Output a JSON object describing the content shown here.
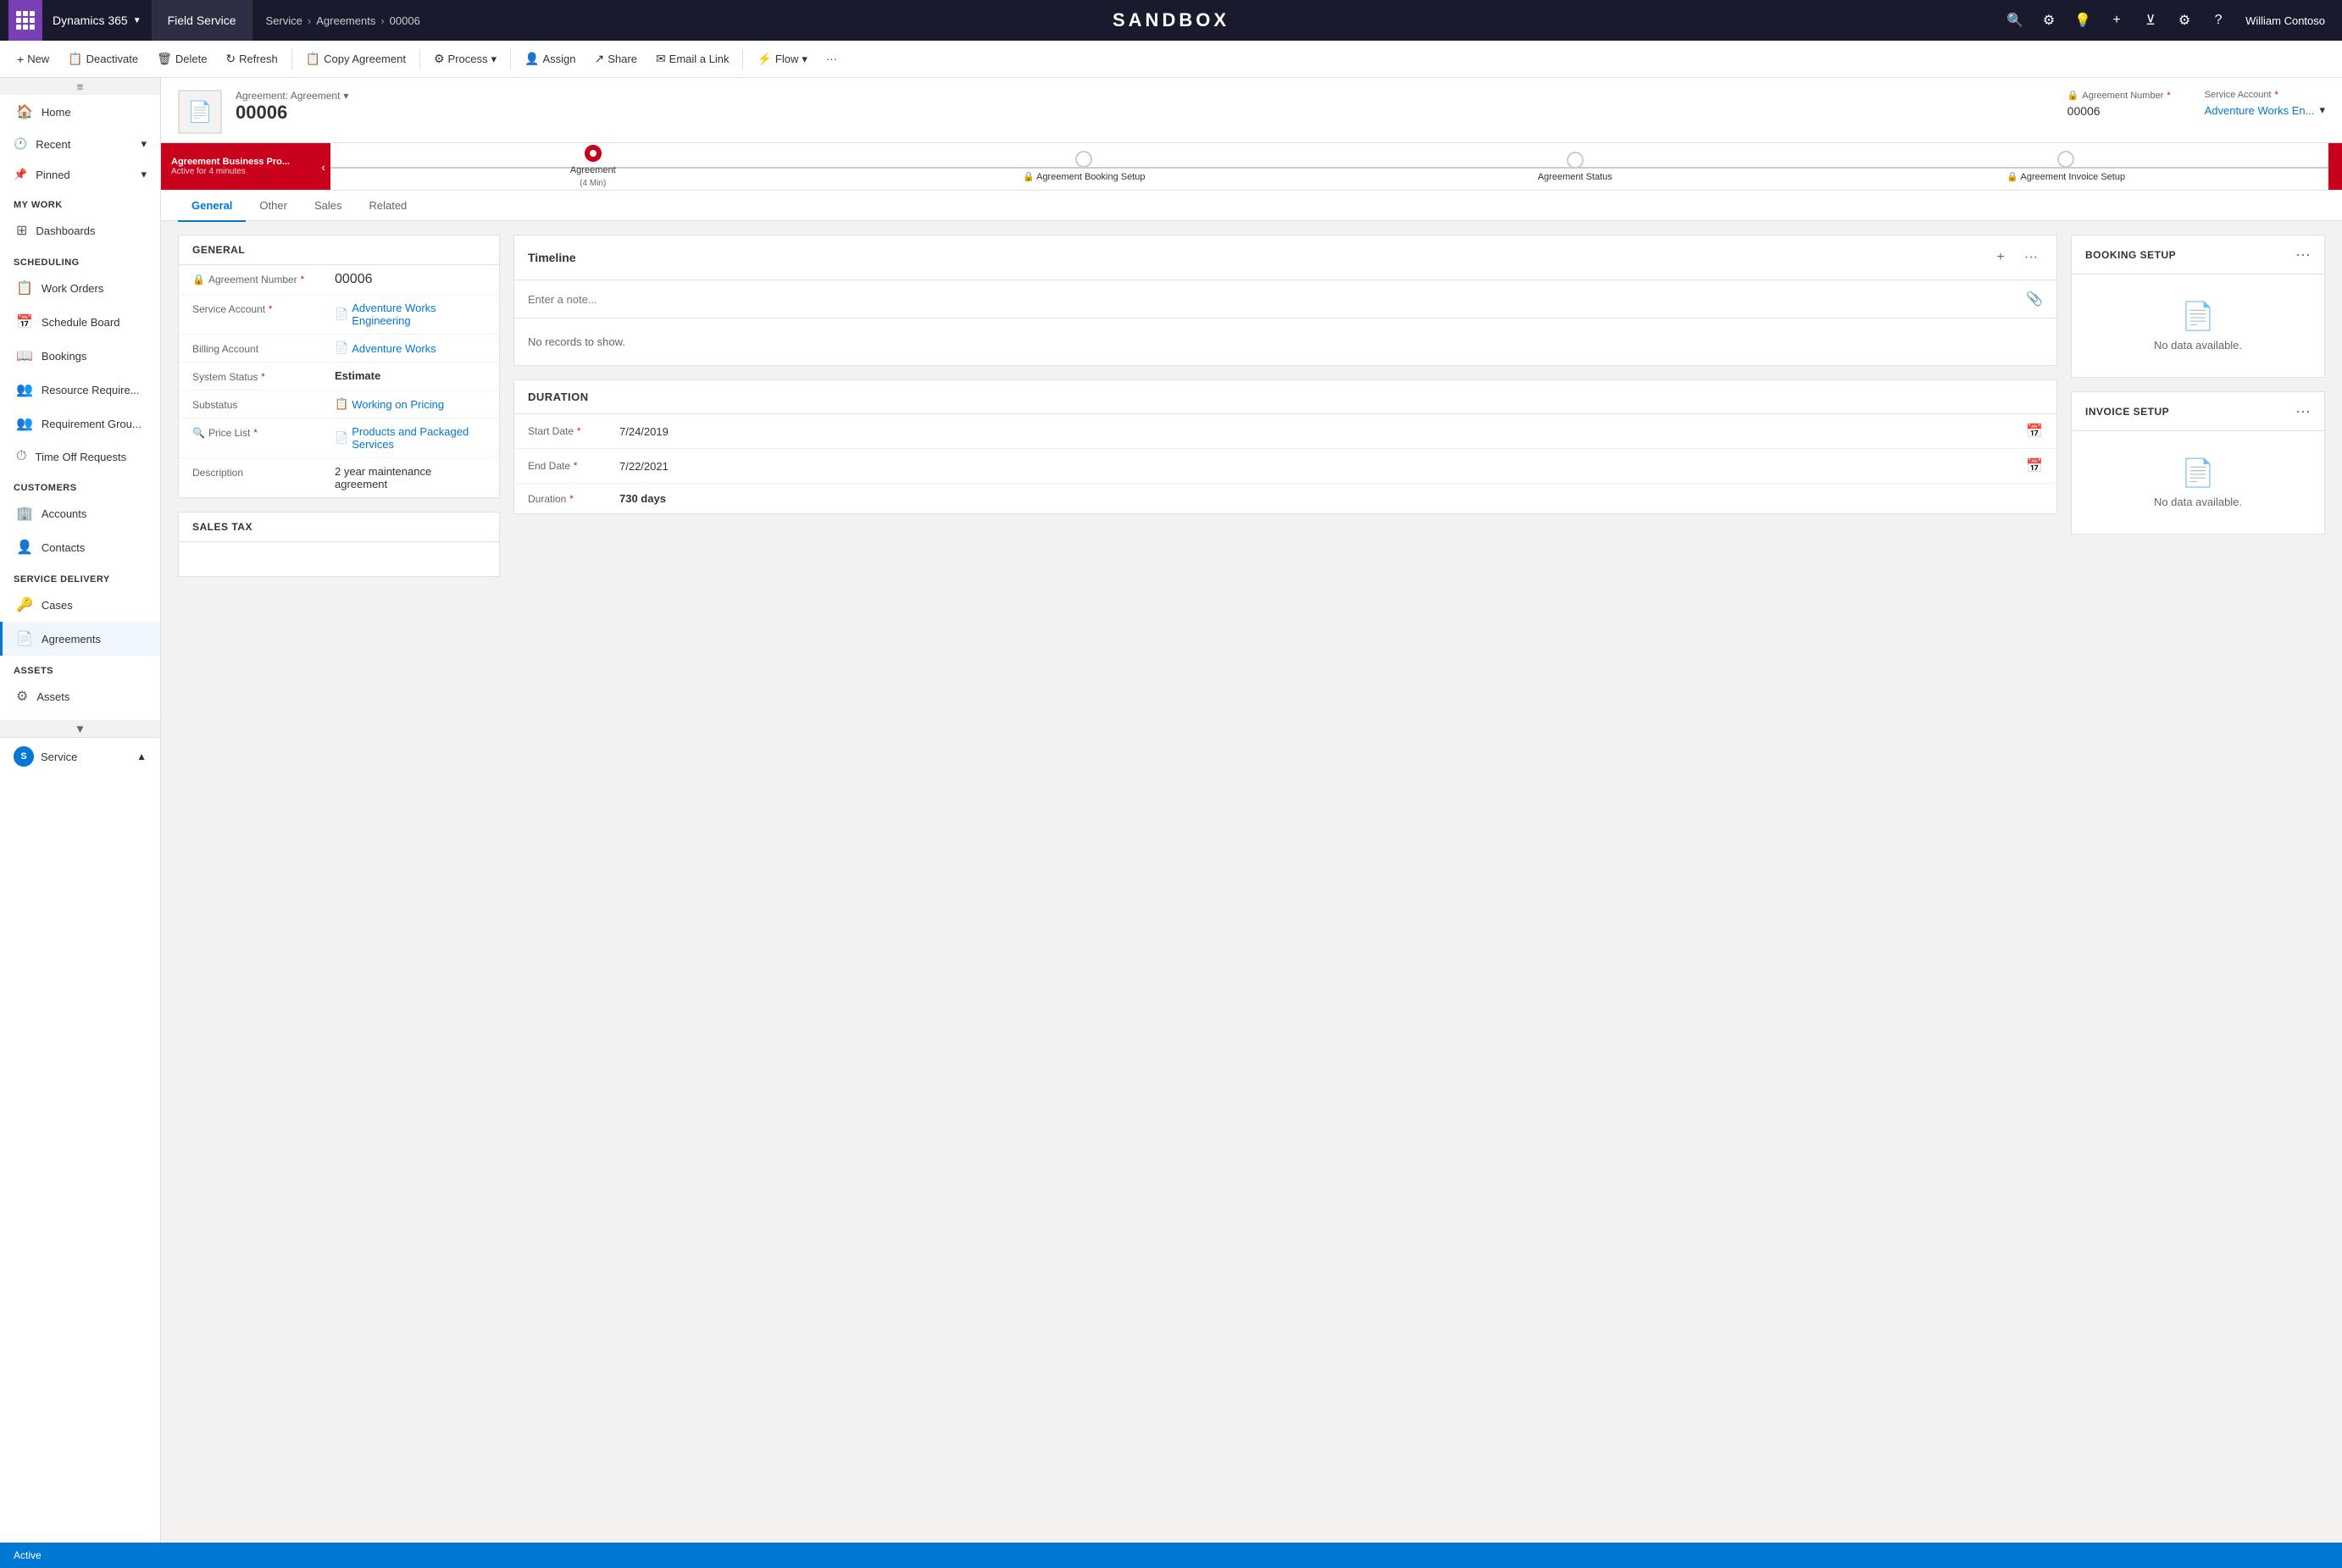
{
  "topnav": {
    "app_label": "Dynamics 365",
    "module_label": "Field Service",
    "breadcrumb": [
      "Service",
      "Agreements",
      "00006"
    ],
    "sandbox_label": "SANDBOX",
    "user_name": "William Contoso",
    "icons": [
      "search",
      "settings-cog",
      "lightbulb",
      "plus",
      "funnel"
    ]
  },
  "toolbar": {
    "buttons": [
      {
        "label": "New",
        "icon": "+",
        "name": "new-button"
      },
      {
        "label": "Deactivate",
        "icon": "📋",
        "name": "deactivate-button"
      },
      {
        "label": "Delete",
        "icon": "🗑",
        "name": "delete-button"
      },
      {
        "label": "Refresh",
        "icon": "🔄",
        "name": "refresh-button"
      },
      {
        "label": "Copy Agreement",
        "icon": "📋",
        "name": "copy-agreement-button"
      },
      {
        "label": "Process",
        "icon": "⚙",
        "name": "process-button"
      },
      {
        "label": "Assign",
        "icon": "👤",
        "name": "assign-button"
      },
      {
        "label": "Share",
        "icon": "↗",
        "name": "share-button"
      },
      {
        "label": "Email a Link",
        "icon": "✉",
        "name": "email-link-button"
      },
      {
        "label": "Flow",
        "icon": "⚡",
        "name": "flow-button"
      },
      {
        "label": "...",
        "icon": "",
        "name": "more-button"
      }
    ]
  },
  "record": {
    "type_label": "Agreement: Agreement",
    "number": "00006",
    "agreement_number_label": "Agreement Number",
    "agreement_number_value": "00006",
    "service_account_label": "Service Account",
    "service_account_value": "Adventure Works En...",
    "required": "*"
  },
  "process_bar": {
    "left_panel_title": "Agreement Business Pro...",
    "left_panel_sub": "Active for 4 minutes",
    "steps": [
      {
        "label": "Agreement",
        "sublabel": "(4 Min)",
        "active": true,
        "locked": false
      },
      {
        "label": "Agreement Booking Setup",
        "sublabel": "",
        "active": false,
        "locked": true
      },
      {
        "label": "Agreement Status",
        "sublabel": "",
        "active": false,
        "locked": true
      },
      {
        "label": "Agreement Invoice Setup",
        "sublabel": "",
        "active": false,
        "locked": true
      }
    ]
  },
  "form_tabs": [
    {
      "label": "General",
      "active": true
    },
    {
      "label": "Other",
      "active": false
    },
    {
      "label": "Sales",
      "active": false
    },
    {
      "label": "Related",
      "active": false
    }
  ],
  "general_section": {
    "title": "GENERAL",
    "fields": [
      {
        "label": "Agreement Number",
        "value": "00006",
        "required": true,
        "locked": true,
        "link": false
      },
      {
        "label": "Service Account",
        "value": "Adventure Works Engineering",
        "required": true,
        "locked": false,
        "link": true
      },
      {
        "label": "Billing Account",
        "value": "Adventure Works",
        "required": false,
        "locked": false,
        "link": true
      },
      {
        "label": "System Status",
        "value": "Estimate",
        "required": true,
        "locked": false,
        "link": false,
        "bold": true
      },
      {
        "label": "Substatus",
        "value": "Working on Pricing",
        "required": false,
        "locked": false,
        "link": true
      },
      {
        "label": "Price List",
        "value": "Products and Packaged Services",
        "required": true,
        "locked": false,
        "link": true
      },
      {
        "label": "Description",
        "value": "2 year maintenance agreement",
        "required": false,
        "locked": false,
        "link": false
      }
    ]
  },
  "timeline": {
    "title": "Timeline",
    "input_placeholder": "Enter a note...",
    "empty_message": "No records to show."
  },
  "duration": {
    "title": "DURATION",
    "fields": [
      {
        "label": "Start Date",
        "value": "7/24/2019",
        "required": true
      },
      {
        "label": "End Date",
        "value": "7/22/2021",
        "required": true
      },
      {
        "label": "Duration",
        "value": "730 days",
        "required": true,
        "bold": true
      }
    ]
  },
  "booking_setup": {
    "title": "BOOKING SETUP",
    "empty_label": "No data available."
  },
  "invoice_setup": {
    "title": "INVOICE SETUP",
    "empty_label": "No data available."
  },
  "sales_tax": {
    "title": "SALES TAX"
  },
  "sidebar": {
    "items_top": [
      {
        "label": "Home",
        "icon": "🏠",
        "name": "sidebar-home"
      },
      {
        "label": "Recent",
        "icon": "🕐",
        "name": "sidebar-recent",
        "expandable": true
      },
      {
        "label": "Pinned",
        "icon": "📌",
        "name": "sidebar-pinned",
        "expandable": true
      }
    ],
    "my_work_section": "My Work",
    "my_work_items": [
      {
        "label": "Dashboards",
        "icon": "⊞",
        "name": "sidebar-dashboards"
      }
    ],
    "scheduling_section": "Scheduling",
    "scheduling_items": [
      {
        "label": "Work Orders",
        "icon": "📋",
        "name": "sidebar-work-orders"
      },
      {
        "label": "Schedule Board",
        "icon": "📅",
        "name": "sidebar-schedule-board"
      },
      {
        "label": "Bookings",
        "icon": "📖",
        "name": "sidebar-bookings"
      },
      {
        "label": "Resource Require...",
        "icon": "👥",
        "name": "sidebar-resource-requirements"
      },
      {
        "label": "Requirement Grou...",
        "icon": "👥",
        "name": "sidebar-requirement-groups"
      },
      {
        "label": "Time Off Requests",
        "icon": "⏱",
        "name": "sidebar-time-off"
      }
    ],
    "customers_section": "Customers",
    "customers_items": [
      {
        "label": "Accounts",
        "icon": "🏢",
        "name": "sidebar-accounts"
      },
      {
        "label": "Contacts",
        "icon": "👤",
        "name": "sidebar-contacts"
      }
    ],
    "service_delivery_section": "Service Delivery",
    "service_delivery_items": [
      {
        "label": "Cases",
        "icon": "🔑",
        "name": "sidebar-cases"
      },
      {
        "label": "Agreements",
        "icon": "📄",
        "name": "sidebar-agreements",
        "active": true
      }
    ],
    "assets_section": "Assets",
    "assets_items": [
      {
        "label": "Assets",
        "icon": "⚙",
        "name": "sidebar-assets"
      }
    ],
    "footer_label": "Service"
  },
  "status_bar": {
    "status": "Active"
  },
  "colors": {
    "brand_blue": "#0078d4",
    "nav_dark": "#1a1a2e",
    "accent_red": "#c8001b",
    "sidebar_active": "#0078d4"
  }
}
